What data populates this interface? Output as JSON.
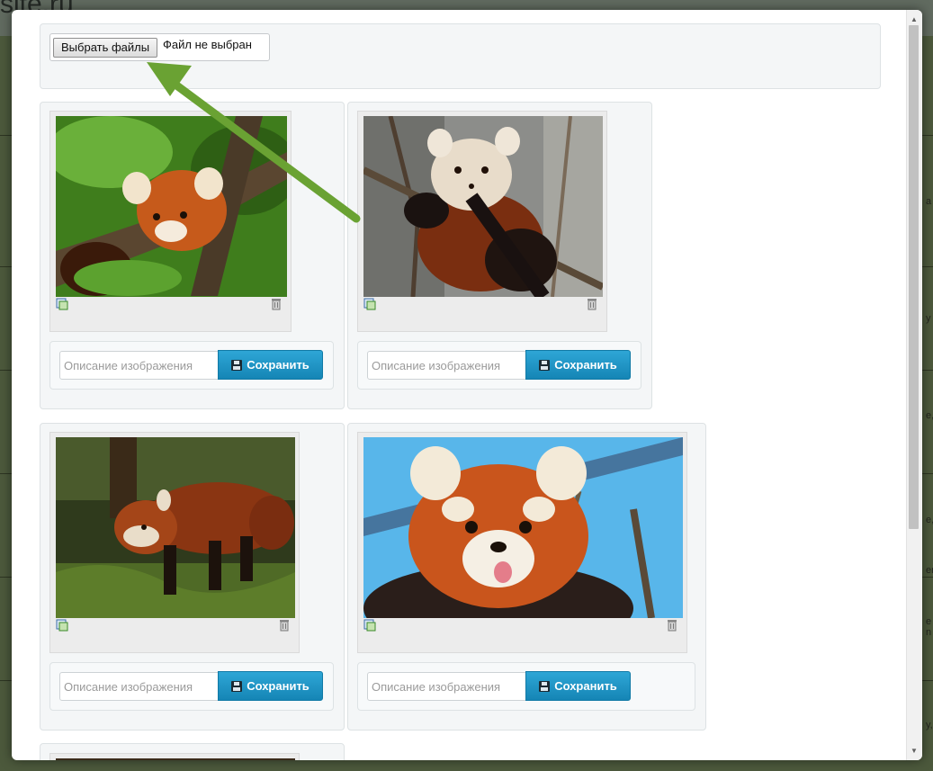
{
  "background": {
    "site_title": "site.ru",
    "edge_fragments": [
      "a",
      "y",
      "e,",
      "e,",
      "er",
      "e n",
      "y,"
    ]
  },
  "upload": {
    "choose_button": "Выбрать файлы",
    "file_status": "Файл не выбран"
  },
  "images": [
    {
      "subject": "red panda in tree with green leaves",
      "description_placeholder": "Описание изображения",
      "save_label": "Сохранить"
    },
    {
      "subject": "red panda on bare branch",
      "description_placeholder": "Описание изображения",
      "save_label": "Сохранить"
    },
    {
      "subject": "red panda walking on grass",
      "description_placeholder": "Описание изображения",
      "save_label": "Сохранить"
    },
    {
      "subject": "red panda face against blue sky",
      "description_placeholder": "Описание изображения",
      "save_label": "Сохранить"
    }
  ],
  "colors": {
    "save_button": "#1a90c2",
    "arrow": "#6aa233",
    "panel_bg": "#f4f6f7"
  },
  "icons": [
    "close-icon",
    "crop-icon",
    "trash-icon",
    "floppy-icon",
    "scroll-up-icon",
    "scroll-down-icon"
  ]
}
